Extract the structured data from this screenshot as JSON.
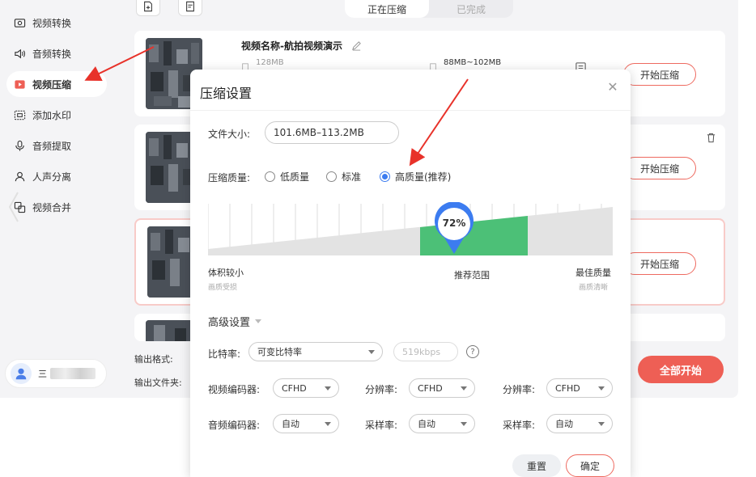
{
  "sidebar": {
    "items": [
      {
        "label": "视频转换",
        "icon": "video-convert-icon",
        "active": false
      },
      {
        "label": "音频转换",
        "icon": "audio-convert-icon",
        "active": false
      },
      {
        "label": "视频压缩",
        "icon": "video-compress-icon",
        "active": true
      },
      {
        "label": "添加水印",
        "icon": "watermark-icon",
        "active": false
      },
      {
        "label": "音频提取",
        "icon": "audio-extract-icon",
        "active": false
      },
      {
        "label": "人声分离",
        "icon": "vocal-separate-icon",
        "active": false
      },
      {
        "label": "视频合并",
        "icon": "video-merge-icon",
        "active": false
      }
    ],
    "user_name_prefix": "三"
  },
  "tabs": {
    "compressing": "正在压缩",
    "done": "已完成"
  },
  "files": [
    {
      "title": "视频名称-航拍视频演示",
      "size": "128MB",
      "target": "88MB~102MB",
      "start_label": "开始压缩"
    },
    {
      "start_label": "开始压缩"
    },
    {
      "start_label": "开始压缩"
    }
  ],
  "bottom": {
    "output_format_label": "输出格式:",
    "output_folder_label": "输出文件夹:",
    "start_all": "全部开始"
  },
  "dialog": {
    "title": "压缩设置",
    "file_size_label": "文件大小:",
    "file_size_value": "101.6MB–113.2MB",
    "quality_label": "压缩质量:",
    "quality_options": [
      "低质量",
      "标准",
      "高质量(推荐)"
    ],
    "quality_selected_index": 2,
    "quality_percent": 72,
    "quality_percent_text": "72%",
    "scale_left": "体积较小",
    "scale_left_sub": "画质受损",
    "scale_mid": "推荐范围",
    "scale_right": "最佳质量",
    "scale_right_sub": "画质清晰",
    "advanced_title": "高级设置",
    "bitrate_label": "比特率:",
    "bitrate_value": "可变比特率",
    "bitrate_kbps_placeholder": "519kbps",
    "video_encoder_label": "视频编码器:",
    "video_encoder_value": "CFHD",
    "resolution_label_1": "分辨率:",
    "resolution_value_1": "CFHD",
    "resolution_label_2": "分辨率:",
    "resolution_value_2": "CFHD",
    "audio_encoder_label": "音频编码器:",
    "audio_encoder_value": "自动",
    "sample_rate_label_1": "采样率:",
    "sample_rate_value_1": "自动",
    "sample_rate_label_2": "采样率:",
    "sample_rate_value_2": "自动",
    "reset": "重置",
    "confirm": "确定"
  },
  "colors": {
    "accent": "#ee5f55",
    "radio": "#3c7cf0",
    "recommended": "#4cc077",
    "gauge": "#3c7cf0"
  }
}
